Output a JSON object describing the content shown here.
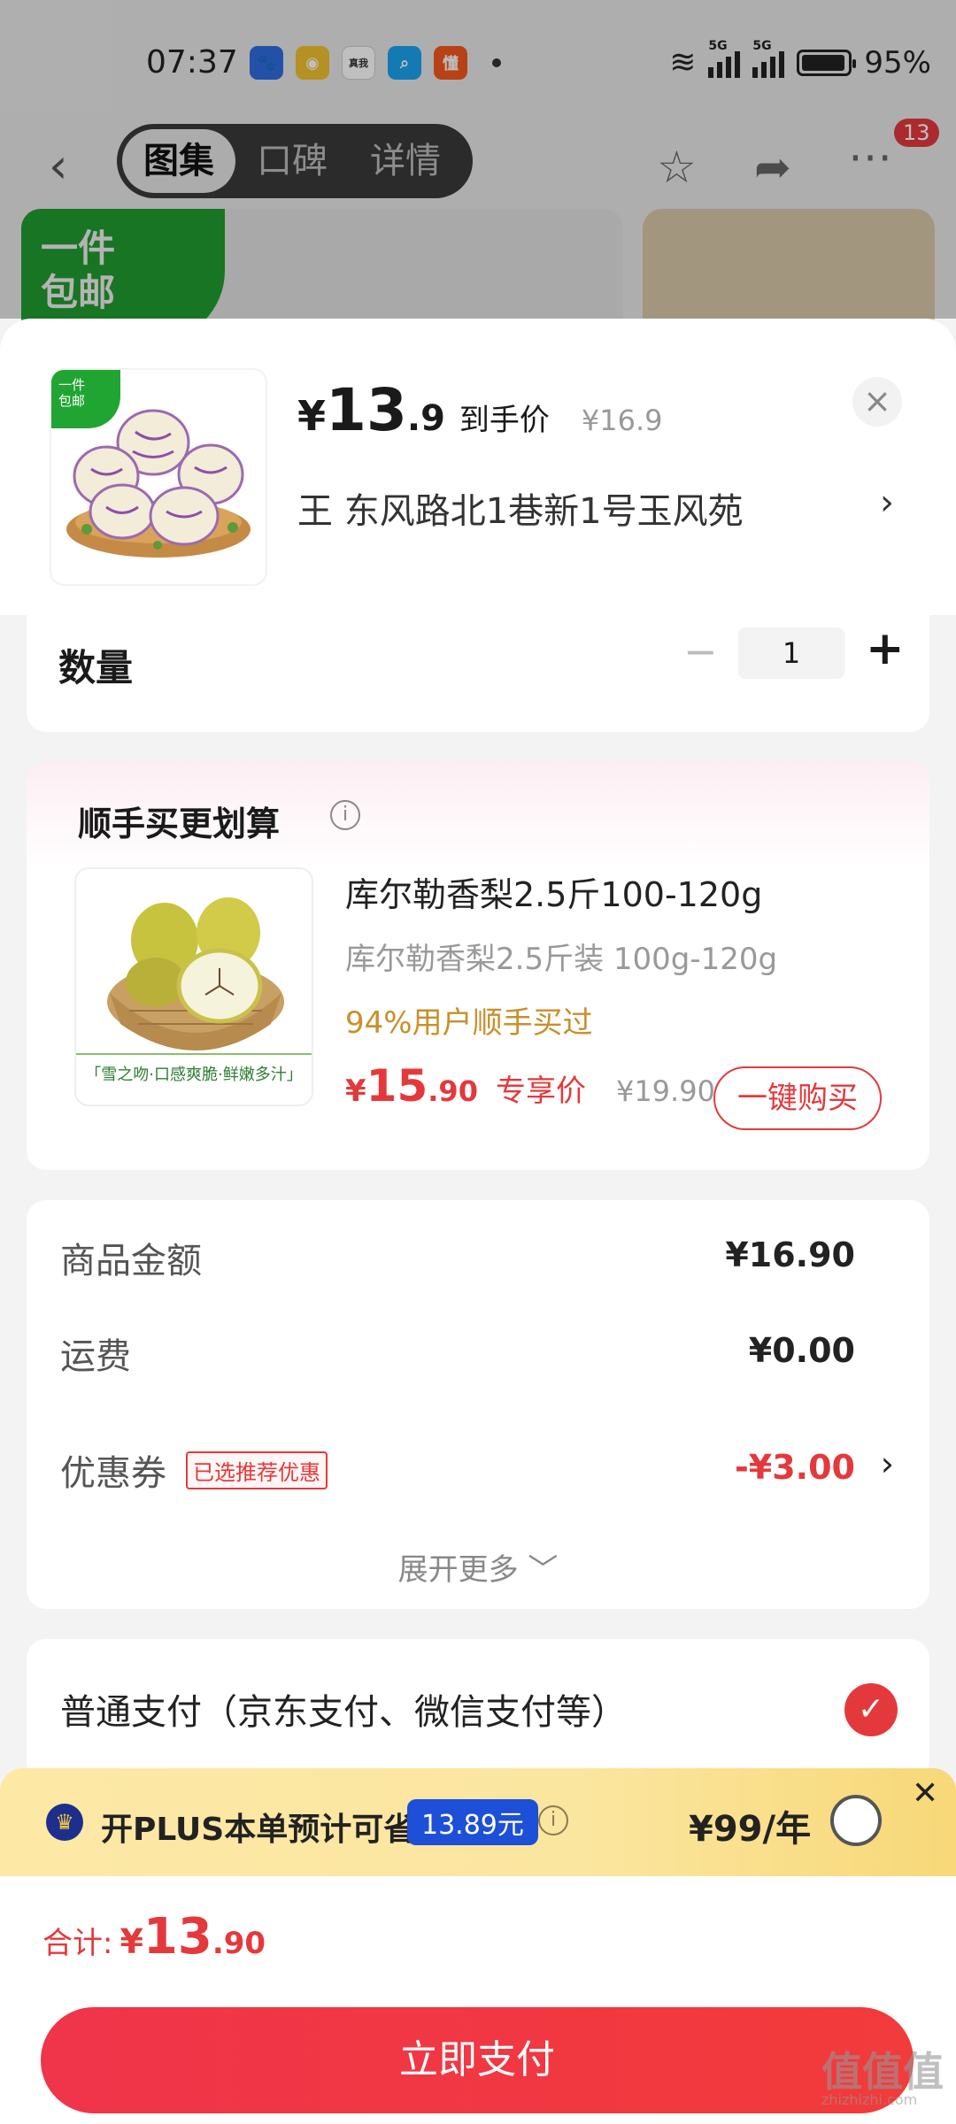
{
  "status_bar": {
    "time": "07:37",
    "battery": "95%",
    "net1": "5G",
    "net2": "5G",
    "app_badges": [
      "百度",
      "微博",
      "真我",
      "搜",
      "懂"
    ]
  },
  "nav": {
    "tabs": [
      "图集",
      "口碑",
      "详情"
    ],
    "active_tab": 0,
    "back_glyph": "‹",
    "badge_count": "13"
  },
  "hero": {
    "tag_line1": "一件",
    "tag_line2": "包邮"
  },
  "product": {
    "thumb_tag_line1": "一件",
    "thumb_tag_line2": "包邮",
    "price_yen": "¥",
    "price_int": "13",
    "price_dec": ".9",
    "price_label": "到手价",
    "original_price": "¥16.9",
    "address": "王  东风路北1巷新1号玉风苑",
    "close": "×",
    "chevron": "›"
  },
  "quantity": {
    "label": "数量",
    "value": "1",
    "minus": "−",
    "plus": "+"
  },
  "upsell": {
    "title": "顺手买更划算",
    "info": "i",
    "item_name": "库尔勒香梨2.5斤100-120g",
    "item_spec": "库尔勒香梨2.5斤装 100g-120g",
    "buy_rate": "94%用户顺手买过",
    "price_yen": "¥",
    "price_int": "15",
    "price_dec": ".90",
    "price_label": "专享价",
    "original_price": "¥19.90",
    "buy_button": "一键购买",
    "image_caption": "「雪之吻·口感爽脆·鲜嫩多汁」"
  },
  "summary": {
    "rows": [
      {
        "label": "商品金额",
        "value": "¥16.90"
      },
      {
        "label": "运费",
        "value": "¥0.00"
      },
      {
        "label": "优惠券",
        "value": "-¥3.00"
      }
    ],
    "coupon_tag": "已选推荐优惠",
    "chevron": "›",
    "expand": "展开更多 ﹀"
  },
  "payment": {
    "label": "普通支付（京东支付、微信支付等）",
    "check": "✓"
  },
  "plus": {
    "crown": "♛",
    "text": "开PLUS本单预计可省",
    "save_amount": "13.89元",
    "info": "i",
    "price": "¥99/年",
    "close": "✕"
  },
  "total": {
    "label": "合计:",
    "yen": "¥",
    "int": "13",
    "dec": ".90",
    "pay_button": "立即支付"
  },
  "watermark": {
    "main": "值值值",
    "sub": "zhizhizhi.com"
  },
  "colors": {
    "accent_red": "#e4393c",
    "plus_blue": "#1e4fd8",
    "green_tag": "#21a532"
  }
}
